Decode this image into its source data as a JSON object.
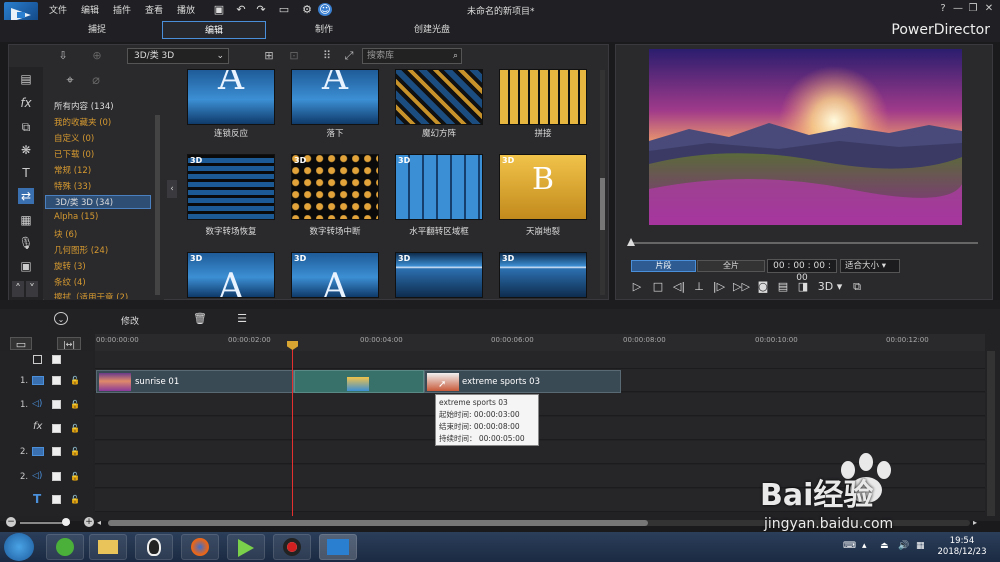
{
  "app": {
    "title": "未命名的新项目*",
    "brand": "PowerDirector",
    "menu": [
      "文件",
      "编辑",
      "插件",
      "查看",
      "播放"
    ],
    "modes": [
      "捕捉",
      "编辑",
      "制作",
      "创建光盘"
    ],
    "active_mode": "编辑"
  },
  "library": {
    "category_dropdown": "3D/类 3D",
    "search_placeholder": "搜索库",
    "categories": [
      "所有内容 (134)",
      "我的收藏夹 (0)",
      "自定义 (0)",
      "已下载 (0)",
      "常规 (12)",
      "特殊 (33)",
      "3D/类 3D (34)",
      "Alpha (15)",
      "块 (6)",
      "几何图形 (24)",
      "旋转 (3)",
      "条纹 (4)",
      "擦拭（适用于章 (2)"
    ],
    "selected_category_index": 6,
    "thumb_labels": [
      "连锁反应",
      "落下",
      "魔幻方阵",
      "拼接",
      "数字转场恢复",
      "数字转场中断",
      "水平翻转区域框",
      "天崩地裂"
    ],
    "badge": "3D",
    "thumb_letters": {
      "a": "A",
      "b": "B"
    }
  },
  "preview": {
    "segment_label": "片段",
    "full_label": "全片",
    "timecode": "00 : 00 : 00 : 00",
    "fit_label": "适合大小",
    "mode_3d": "3D"
  },
  "timeline": {
    "modify_label": "修改",
    "ruler": [
      "00:00:00:00",
      "00:00:02:00",
      "00:00:04:00",
      "00:00:06:00",
      "00:00:08:00",
      "00:00:10:00",
      "00:00:12:00"
    ],
    "track_labels": [
      "1.",
      "1.",
      "2.",
      "2."
    ],
    "clips": [
      {
        "name": "sunrise 01"
      },
      {
        "name": "extreme sports 03"
      }
    ],
    "tooltip": {
      "title": "extreme sports 03",
      "start": "起始时间: 00:00:03:00",
      "end": "结束时间: 00:00:08:00",
      "duration": "持续时间： 00:00:05:00"
    }
  },
  "taskbar": {
    "time": "19:54",
    "date": "2018/12/23"
  },
  "watermark": {
    "text": "Bai经验",
    "url": "jingyan.baidu.com"
  }
}
